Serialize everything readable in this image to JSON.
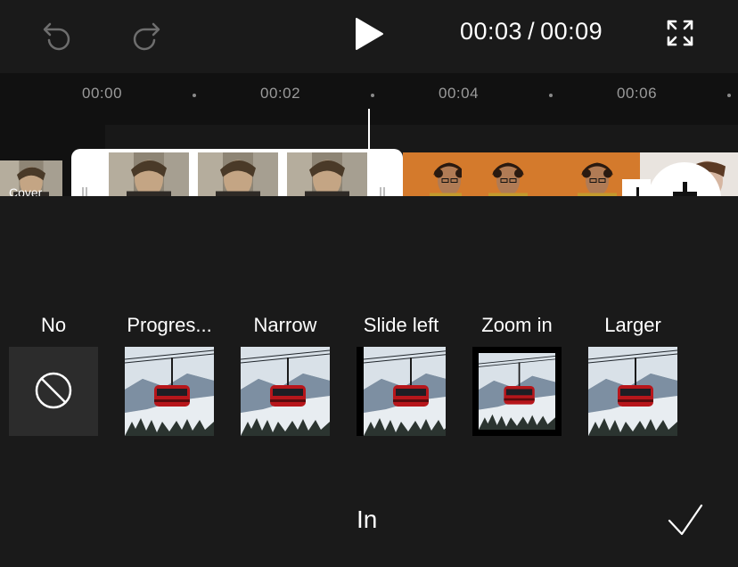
{
  "top": {
    "undo_icon": "undo-icon",
    "redo_icon": "redo-icon",
    "play_icon": "play-icon",
    "fullscreen_icon": "fullscreen-icon",
    "current_time": "00:03",
    "separator": "/",
    "total_time": "00:09"
  },
  "ruler": {
    "labels": [
      "00:00",
      "00:02",
      "00:04",
      "00:06"
    ]
  },
  "timeline": {
    "cover_label": "Cover",
    "add_icon": "plus-icon"
  },
  "animations": {
    "items": [
      {
        "label": "No",
        "icon": "none-icon"
      },
      {
        "label": "Progres...",
        "icon": "preview-thumbnail"
      },
      {
        "label": "Narrow",
        "icon": "preview-thumbnail"
      },
      {
        "label": "Slide left",
        "icon": "preview-thumbnail"
      },
      {
        "label": "Zoom in",
        "icon": "preview-thumbnail"
      },
      {
        "label": "Larger",
        "icon": "preview-thumbnail"
      }
    ]
  },
  "bottom": {
    "tab_label": "In",
    "confirm_icon": "checkmark-icon"
  },
  "colors": {
    "background": "#1a1a1a",
    "timeline_background": "#111111",
    "text": "#ffffff",
    "tick_text": "#9a9a9a",
    "clip_selection": "#ffffff",
    "orange_clip": "#d47a2c"
  }
}
